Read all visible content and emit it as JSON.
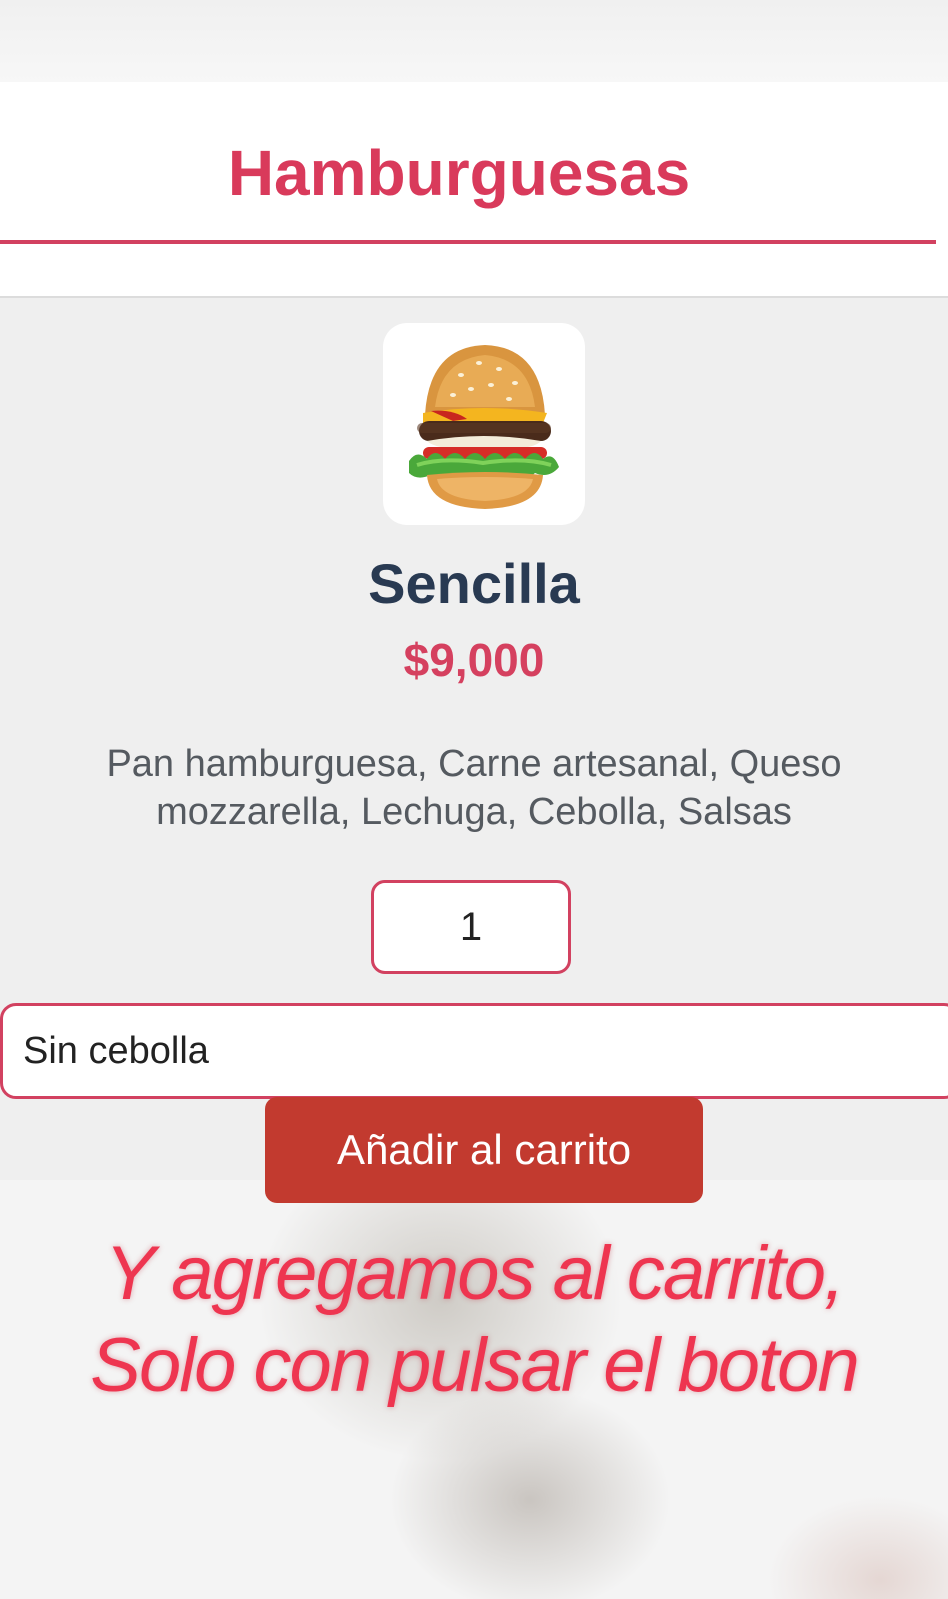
{
  "header": {
    "title": "Hamburguesas"
  },
  "product": {
    "image_icon": "burger-icon",
    "name": "Sencilla",
    "price": "$9,000",
    "description": "Pan hamburguesa, Carne artesanal, Queso mozzarella, Lechuga, Cebolla, Salsas"
  },
  "form": {
    "quantity": "1",
    "notes": "Sin cebolla",
    "add_label": "Añadir al carrito"
  },
  "caption": {
    "line1": "Y agregamos al carrito,",
    "line2": "Solo con pulsar el boton"
  },
  "colors": {
    "accent": "#d93a5b",
    "button": "#c23a2f",
    "name": "#293a52"
  }
}
